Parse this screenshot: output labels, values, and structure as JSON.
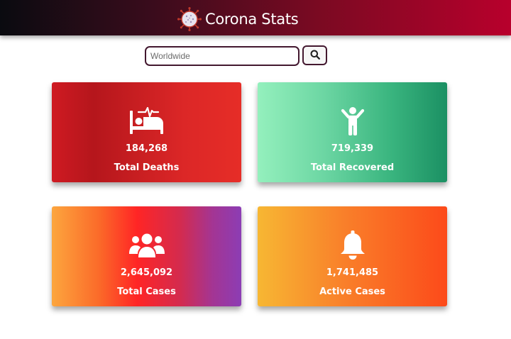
{
  "header": {
    "title": "Corona Stats",
    "logo_icon": "virus-icon"
  },
  "search": {
    "placeholder": "Worldwide",
    "value": "",
    "button_icon": "search-icon"
  },
  "cards": [
    {
      "id": "deaths",
      "icon": "hospital-bed-heartbeat-icon",
      "value": "184,268",
      "label": "Total Deaths"
    },
    {
      "id": "recovered",
      "icon": "person-raised-arms-icon",
      "value": "719,339",
      "label": "Total Recovered"
    },
    {
      "id": "cases",
      "icon": "users-group-icon",
      "value": "2,645,092",
      "label": "Total Cases"
    },
    {
      "id": "active",
      "icon": "bell-icon",
      "value": "1,741,485",
      "label": "Active Cases"
    }
  ],
  "colors": {
    "header_dark": "#0a0b10",
    "header_red": "#b8002c",
    "search_border": "#43182f",
    "deaths": "#cf1a22",
    "recovered": "#3ab57f",
    "cases_start": "#fca63e",
    "cases_end": "#8c3db4",
    "active_start": "#f7b733",
    "active_end": "#fc4a1a"
  }
}
